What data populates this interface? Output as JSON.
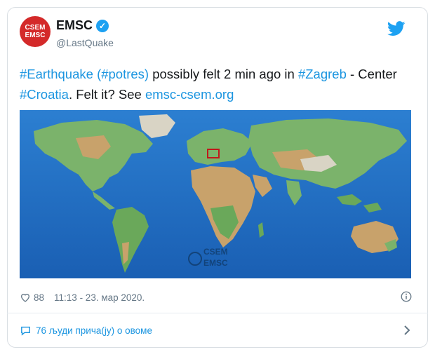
{
  "author": {
    "name": "EMSC",
    "handle": "@LastQuake",
    "avatar_top": "CSEM",
    "avatar_bottom": "EMSC",
    "verified_icon": "verified-badge-icon"
  },
  "tweet": {
    "segments": [
      {
        "text": "#Earthquake",
        "link": true
      },
      {
        "text": " ",
        "link": false
      },
      {
        "text": "(#potres)",
        "link": true
      },
      {
        "text": " possibly felt 2 min ago in ",
        "link": false
      },
      {
        "text": "#Zagreb",
        "link": true
      },
      {
        "text": " - Center ",
        "link": false
      },
      {
        "text": "#Croatia",
        "link": true
      },
      {
        "text": ". Felt it? See ",
        "link": false
      },
      {
        "text": "emsc-csem.org",
        "link": true
      }
    ]
  },
  "media": {
    "watermark_top": "CSEM",
    "watermark_bottom": "EMSC",
    "ocean_color": "#1f6fc4",
    "land_color": "#7bb36b"
  },
  "meta": {
    "likes": "88",
    "timestamp": "11:13 - 23. мар 2020."
  },
  "footer": {
    "conversation": "76 људи прича(ју) о овоме"
  },
  "colors": {
    "link": "#1b95e0",
    "muted": "#657786",
    "brand": "#1da1f2",
    "avatar": "#d42a2a"
  }
}
